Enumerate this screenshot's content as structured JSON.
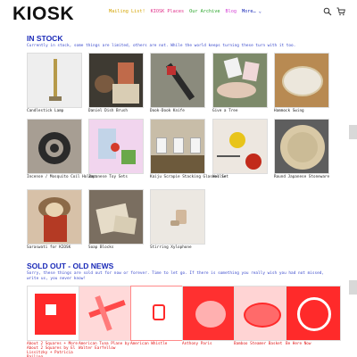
{
  "header": {
    "logo": "KIOSK",
    "nav": [
      {
        "label": "Mailing List!",
        "color": "#d4a300"
      },
      {
        "label": "KIOSK Places",
        "color": "#e0308a"
      },
      {
        "label": "Our Archive",
        "color": "#2aa52a"
      },
      {
        "label": "Blog",
        "color": "#d43cd4"
      },
      {
        "label": "More… ⌄",
        "color": "#1a2ab8"
      }
    ]
  },
  "in_stock": {
    "title": "IN STOCK",
    "intro": "Currently in stock, some things are limited, others are not. While the world keeps turning these turn with it too.",
    "items": [
      {
        "label": "Candlestick Lamp"
      },
      {
        "label": "Daniel Dish Brush"
      },
      {
        "label": "Dook-Dook Knife"
      },
      {
        "label": "Give a Tree"
      },
      {
        "label": "Hammock Swing"
      },
      {
        "label": "Incense / Mosquito Coil Holder"
      },
      {
        "label": "Japanese Toy Sets"
      },
      {
        "label": "Kaiju Scrapie Stacking Glasses Set"
      },
      {
        "label": "Hollie"
      },
      {
        "label": "Round Japanese Stoneware"
      },
      {
        "label": "Saraswati for KIOSK"
      },
      {
        "label": "Soap Blocks"
      },
      {
        "label": "Stirring Xylophone"
      }
    ]
  },
  "sold_out": {
    "title": "SOLD OUT - OLD NEWS",
    "intro": "Sorry, these things are sold out for now or forever. Time to let go. If there is something you really wish you had not missed, write us, you never know!",
    "items": [
      {
        "label": "About 2 Squares + More About 2 Squares by El Lissitzky + Patricia Railing"
      },
      {
        "label": "American Tuna Plane by Walter Earfellow"
      },
      {
        "label": "American Whistle"
      },
      {
        "label": "Anthony Paris"
      },
      {
        "label": "Bamboo Steamer Basket"
      },
      {
        "label": "Be Here Now"
      }
    ]
  }
}
